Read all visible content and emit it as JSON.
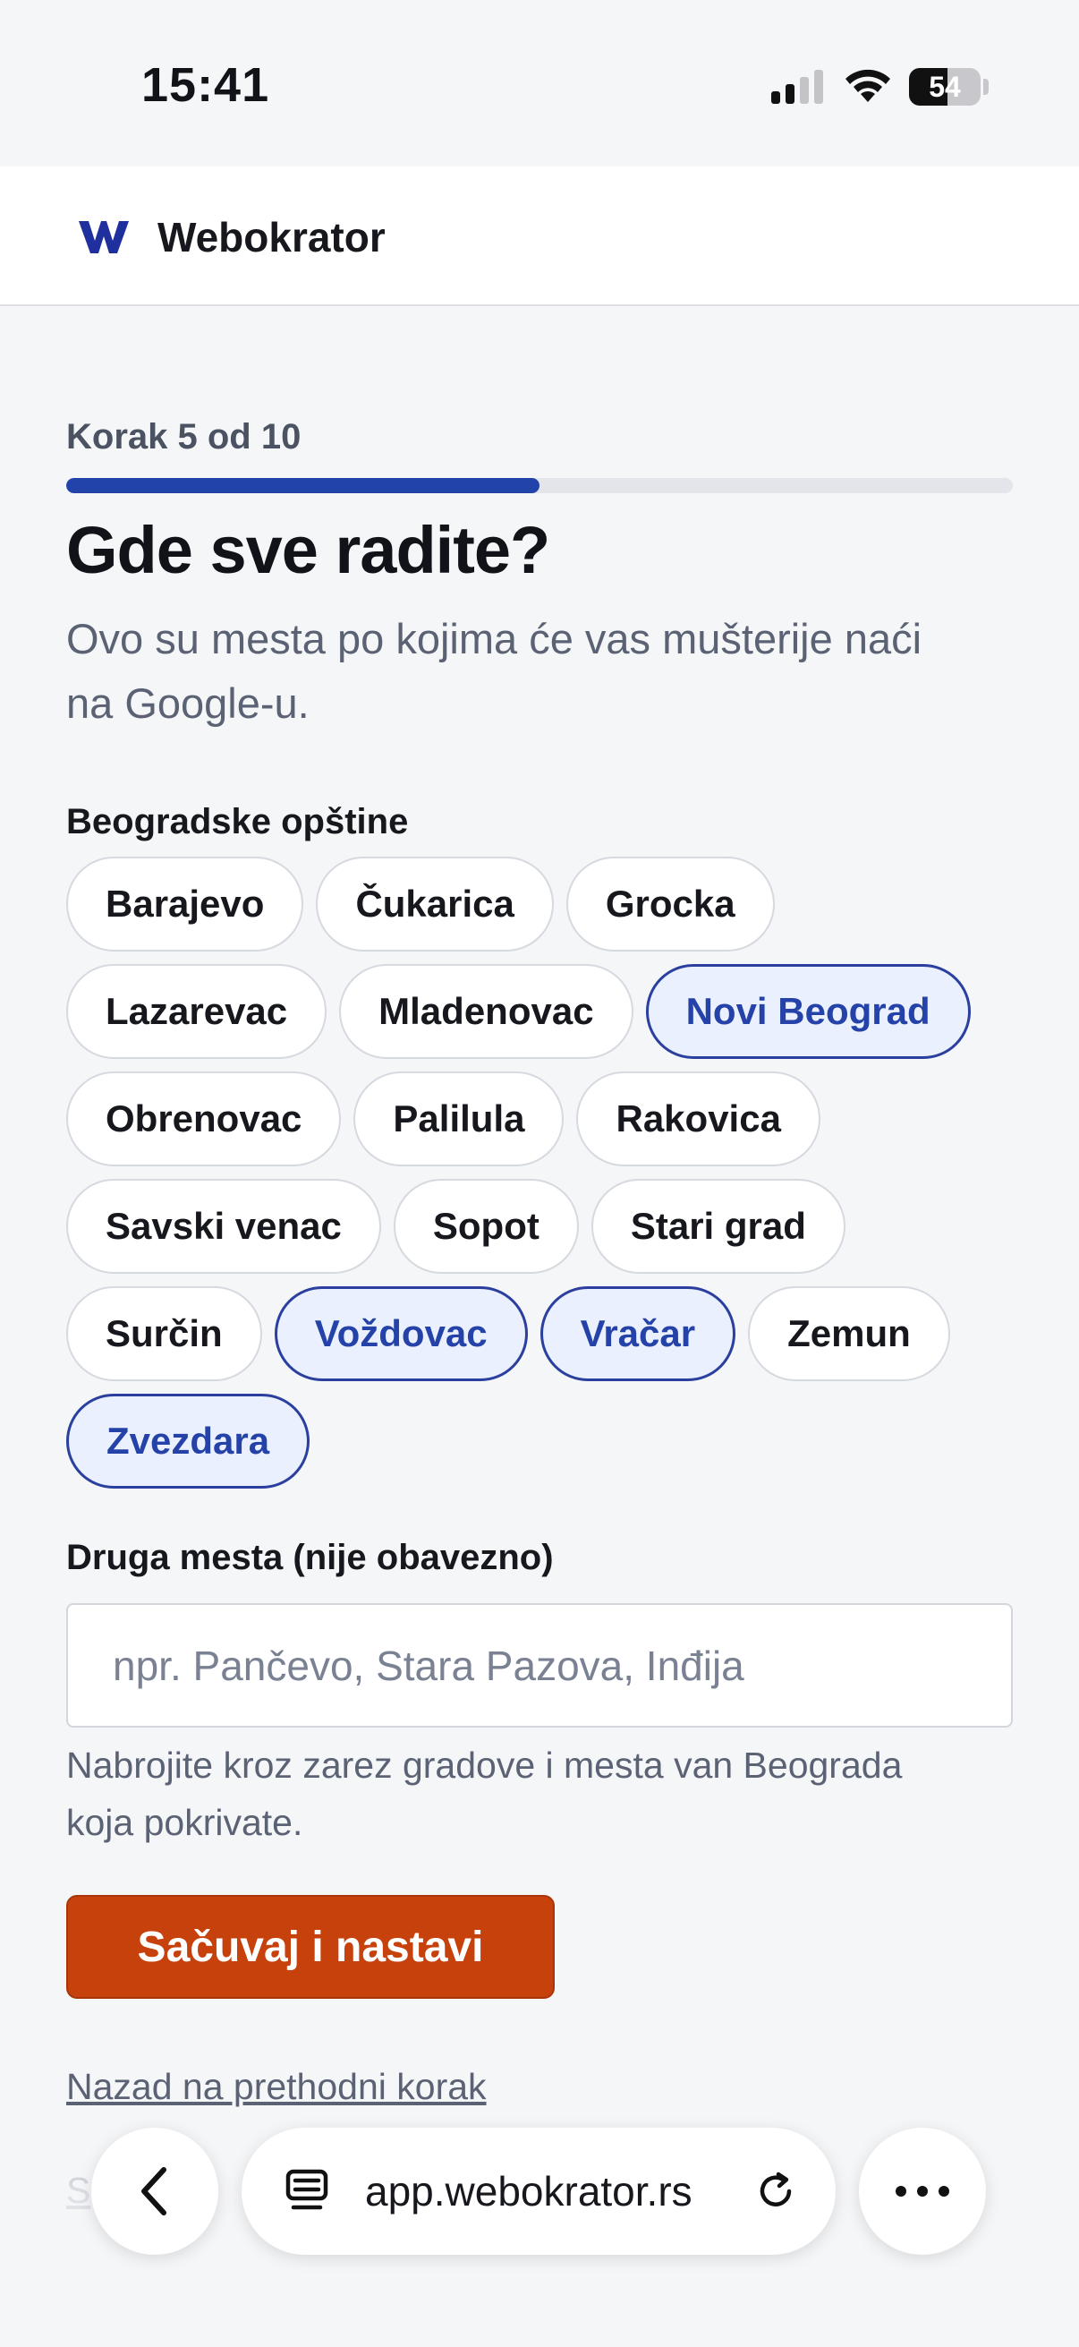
{
  "status_bar": {
    "time": "15:41",
    "battery": "54",
    "battery_level": 0.54
  },
  "header": {
    "brand": "Webokrator"
  },
  "wizard": {
    "step_label": "Korak 5 od 10",
    "progress": 0.5,
    "title": "Gde sve radite?",
    "subtitle": "Ovo su mesta po kojima će vas mušterije naći na Google-u."
  },
  "municipalities": {
    "label": "Beogradske opštine",
    "items": [
      {
        "label": "Barajevo",
        "selected": false
      },
      {
        "label": "Čukarica",
        "selected": false
      },
      {
        "label": "Grocka",
        "selected": false
      },
      {
        "label": "Lazarevac",
        "selected": false
      },
      {
        "label": "Mladenovac",
        "selected": false
      },
      {
        "label": "Novi Beograd",
        "selected": true
      },
      {
        "label": "Obrenovac",
        "selected": false
      },
      {
        "label": "Palilula",
        "selected": false
      },
      {
        "label": "Rakovica",
        "selected": false
      },
      {
        "label": "Savski venac",
        "selected": false
      },
      {
        "label": "Sopot",
        "selected": false
      },
      {
        "label": "Stari grad",
        "selected": false
      },
      {
        "label": "Surčin",
        "selected": false
      },
      {
        "label": "Voždovac",
        "selected": true
      },
      {
        "label": "Vračar",
        "selected": true
      },
      {
        "label": "Zemun",
        "selected": false
      },
      {
        "label": "Zvezdara",
        "selected": true
      }
    ]
  },
  "other_places": {
    "label": "Druga mesta (nije obavezno)",
    "value": "",
    "placeholder": "npr. Pančevo, Stara Pazova, Inđija",
    "hint": "Nabrojite kroz zarez gradove i mesta van Beograda koja pokrivate."
  },
  "actions": {
    "save_label": "Sačuvaj i nastavi",
    "back_label": "Nazad na prethodni korak",
    "skip_label": "S"
  },
  "browser": {
    "url": "app.webokrator.rs"
  }
}
